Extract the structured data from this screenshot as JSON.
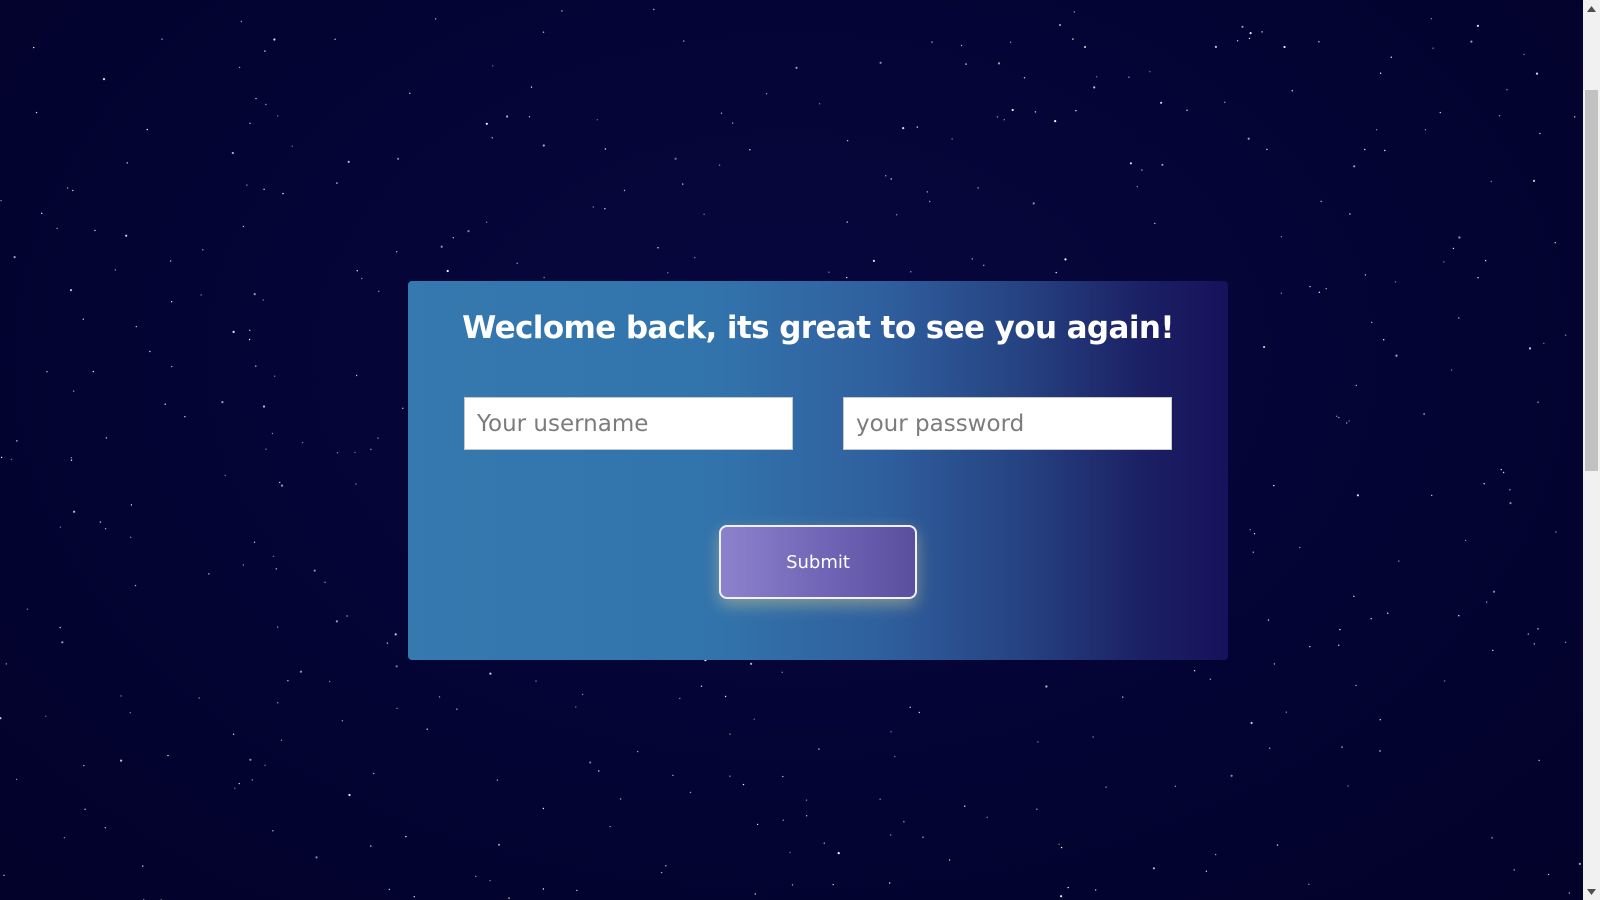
{
  "login": {
    "title": "Weclome back, its great to see you again!",
    "username_placeholder": "Your username",
    "username_value": "",
    "password_placeholder": "your password",
    "password_value": "",
    "submit_label": "Submit"
  },
  "colors": {
    "background": "#040434",
    "card_gradient_start": "#3579af",
    "card_gradient_end": "#16125b",
    "button_gradient_start": "#8c82cc",
    "button_gradient_end": "#5a4e9e"
  },
  "icons": {
    "scroll_up": "triangle-up-icon",
    "scroll_down": "triangle-down-icon"
  },
  "scrollbar": {
    "scroll_position_fraction": 0.15,
    "visible_fraction": 0.44
  }
}
